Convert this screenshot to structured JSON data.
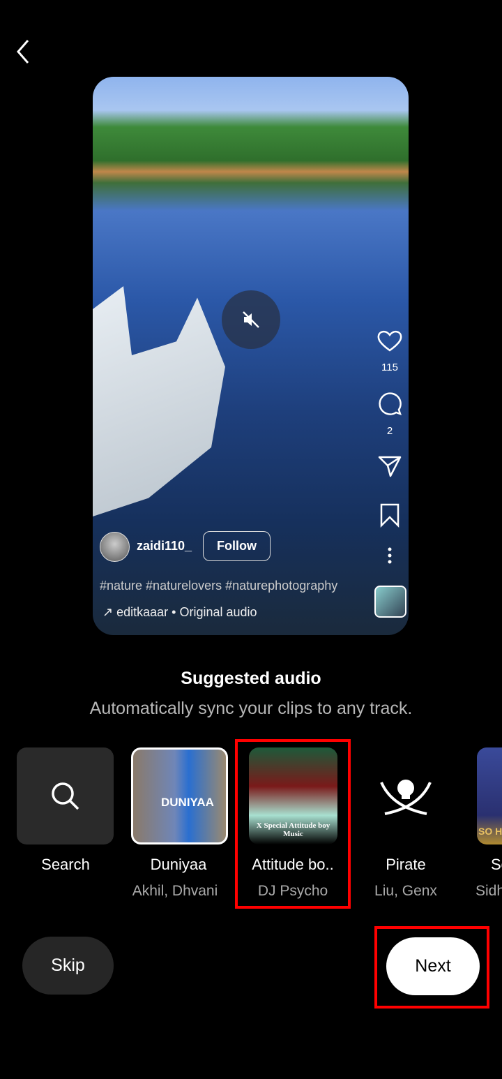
{
  "video": {
    "likes": "115",
    "comments": "2",
    "username": "zaidi110_",
    "follow_label": "Follow",
    "caption": "#nature #naturelovers #naturephotography",
    "audio": "editkaaar • Original audio"
  },
  "suggested": {
    "title": "Suggested audio",
    "subtitle": "Automatically sync your clips to any track.",
    "items": [
      {
        "title": "Search",
        "artist": ""
      },
      {
        "title": "Duniyaa",
        "artist": "Akhil, Dhvani"
      },
      {
        "title": "Attitude bo..",
        "artist": "DJ Psycho"
      },
      {
        "title": "Pirate",
        "artist": "Liu, Genx"
      },
      {
        "title": "So High",
        "artist": "Sidhu"
      }
    ],
    "cover_text": {
      "duniyaa": "DUNIYAA",
      "attitude": "X Special Attitude boy Music",
      "sohigh": "SO HI"
    }
  },
  "buttons": {
    "skip": "Skip",
    "next": "Next"
  },
  "colors": {
    "highlight": "#ff0000",
    "next_bg": "#ffffff",
    "skip_bg": "#262626"
  }
}
